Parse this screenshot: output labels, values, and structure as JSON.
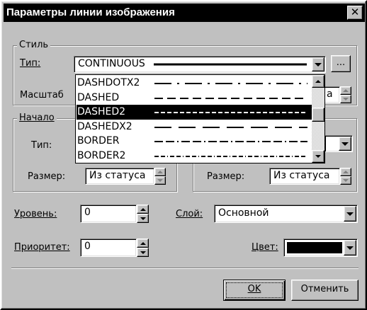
{
  "window": {
    "title": "Параметры линии изображения",
    "close_glyph": "✕"
  },
  "style_group": {
    "label": "Стиль",
    "type_label": "Тип:",
    "type_value": "CONTINUOUS",
    "browse_label": "...",
    "scale_label": "Масштаб",
    "scale_partial_value": "а"
  },
  "linetypes": [
    {
      "name": "DASHDOTX2",
      "selected": false
    },
    {
      "name": "DASHED",
      "selected": false
    },
    {
      "name": "DASHED2",
      "selected": true
    },
    {
      "name": "DASHEDX2",
      "selected": false
    },
    {
      "name": "BORDER",
      "selected": false
    },
    {
      "name": "BORDER2",
      "selected": false
    }
  ],
  "start_group": {
    "label": "Начало",
    "type_label": "Тип:",
    "size_label": "Размер:",
    "size_value": "Из статуса"
  },
  "end_group": {
    "size_label": "Размер:",
    "size_value": "Из статуса"
  },
  "level": {
    "label": "Уровень:",
    "value": "0"
  },
  "layer": {
    "label": "Слой:",
    "value": "Основной"
  },
  "priority": {
    "label": "Приоритет:",
    "value": "0"
  },
  "color": {
    "label": "Цвет:",
    "swatch": "#000000"
  },
  "buttons": {
    "ok": "OK",
    "cancel": "Отменить"
  }
}
